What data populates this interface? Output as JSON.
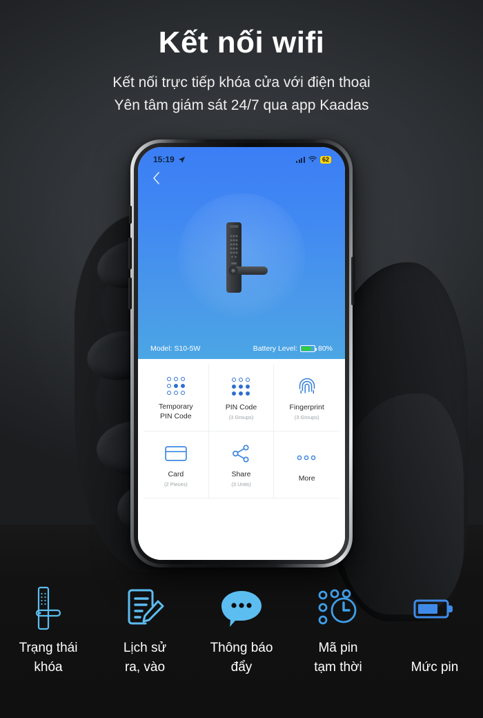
{
  "header": {
    "title": "Kết nối wifi",
    "subtitle_line1": "Kết nối trực tiếp khóa cửa với điện thoại",
    "subtitle_line2": "Yên tâm giám sát 24/7 qua app Kaadas"
  },
  "colors": {
    "background_top": "#30343a",
    "background_bottom": "#121212",
    "app_blue_top": "#3b7ef5",
    "app_blue_bottom": "#4ba6e4",
    "icon_blue": "#5cbdf0",
    "accent_blue": "#2f6fd0",
    "battery_green": "#2ecc40",
    "status_battery_yellow": "#ffd60a"
  },
  "phone": {
    "statusbar": {
      "time": "15:19",
      "location_icon": "location-arrow-icon",
      "signal_icon": "cellular-signal-icon",
      "wifi_icon": "wifi-icon",
      "battery_value": "62"
    },
    "back_icon": "chevron-left-icon",
    "lock_image": "smart-door-lock-image",
    "info": {
      "model_label": "Model: S10-5W",
      "battery_label": "Battery Level:",
      "battery_percent": "80%",
      "battery_fill": 80
    },
    "grid": [
      {
        "icon": "keypad-dots-icon",
        "label": "Temporary\nPIN Code",
        "label_line1": "Temporary",
        "label_line2": "PIN Code",
        "sub": ""
      },
      {
        "icon": "keypad-dots-icon",
        "label": "PIN Code",
        "label_line1": "PIN Code",
        "label_line2": "",
        "sub": "(3 Groups)"
      },
      {
        "icon": "fingerprint-icon",
        "label": "Fingerprint",
        "label_line1": "Fingerprint",
        "label_line2": "",
        "sub": "(3 Groups)"
      },
      {
        "icon": "card-icon",
        "label": "Card",
        "label_line1": "Card",
        "label_line2": "",
        "sub": "(2 Pieces)"
      },
      {
        "icon": "share-icon",
        "label": "Share",
        "label_line1": "Share",
        "label_line2": "",
        "sub": "(3 Units)"
      },
      {
        "icon": "more-dots-icon",
        "label": "More",
        "label_line1": "More",
        "label_line2": "",
        "sub": ""
      }
    ]
  },
  "features": [
    {
      "icon": "door-lock-icon",
      "label_line1": "Trạng thái",
      "label_line2": "khóa"
    },
    {
      "icon": "history-log-icon",
      "label_line1": "Lịch sử",
      "label_line2": "ra, vào"
    },
    {
      "icon": "chat-bubble-icon",
      "label_line1": "Thông báo",
      "label_line2": "đẩy"
    },
    {
      "icon": "temp-pin-clock-icon",
      "label_line1": "Mã pin",
      "label_line2": "tạm thời"
    },
    {
      "icon": "battery-icon",
      "label_line1": "Mức pin",
      "label_line2": ""
    }
  ]
}
